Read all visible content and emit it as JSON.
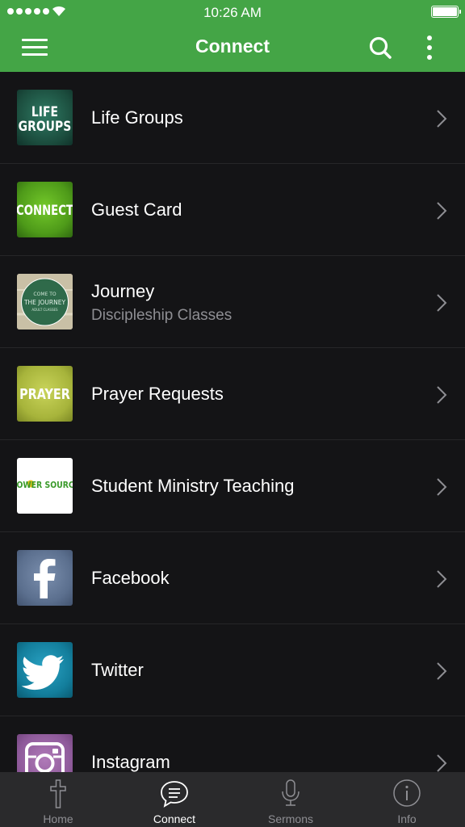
{
  "status": {
    "time": "10:26 AM"
  },
  "nav": {
    "title": "Connect"
  },
  "items": [
    {
      "label": "Life Groups",
      "thumb": "LIFE\nGROUPS",
      "icon": "life-groups-logo"
    },
    {
      "label": "Guest Card",
      "thumb": "CONNECT",
      "icon": "connect-logo"
    },
    {
      "label": "Journey",
      "subtitle": "Discipleship Classes",
      "thumb": "COME TO\nTHE JOURNEY\nADULT CLASSES",
      "icon": "journey-logo"
    },
    {
      "label": "Prayer Requests",
      "thumb": "PRAYER",
      "icon": "prayer-logo"
    },
    {
      "label": "Student Ministry Teaching",
      "thumb": "POWER SOURCE",
      "icon": "power-source-logo"
    },
    {
      "label": "Facebook",
      "icon": "facebook-icon"
    },
    {
      "label": "Twitter",
      "icon": "twitter-icon"
    },
    {
      "label": "Instagram",
      "icon": "instagram-icon"
    }
  ],
  "tabs": [
    {
      "label": "Home",
      "icon": "cross-icon"
    },
    {
      "label": "Connect",
      "icon": "chat-icon",
      "active": true
    },
    {
      "label": "Sermons",
      "icon": "microphone-icon"
    },
    {
      "label": "Info",
      "icon": "info-icon"
    }
  ],
  "colors": {
    "header": "#44a546",
    "background": "#141416",
    "tabbar": "#2a2a2c"
  }
}
